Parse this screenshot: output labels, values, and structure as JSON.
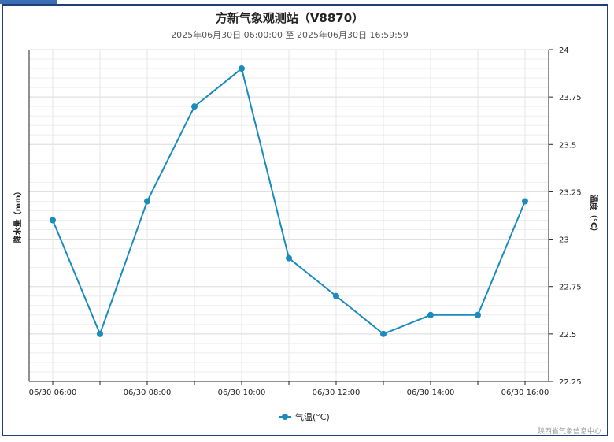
{
  "chart_data": {
    "type": "line",
    "title": "方新气象观测站（V8870）",
    "subtitle": "2025年06月30日 06:00:00 至 2025年06月30日 16:59:59",
    "ylabel_left": "降水量（mm）",
    "ylabel_right": "温度（°C）",
    "x": [
      "06:00",
      "07:00",
      "08:00",
      "09:00",
      "10:00",
      "11:00",
      "12:00",
      "13:00",
      "14:00",
      "15:00",
      "16:00"
    ],
    "x_tick_labels": [
      {
        "index": 0,
        "label": "06/30 06:00"
      },
      {
        "index": 2,
        "label": "06/30 08:00"
      },
      {
        "index": 4,
        "label": "06/30 10:00"
      },
      {
        "index": 6,
        "label": "06/30 12:00"
      },
      {
        "index": 8,
        "label": "06/30 14:00"
      },
      {
        "index": 10,
        "label": "06/30 16:00"
      }
    ],
    "series": [
      {
        "name": "气温(°C)",
        "color": "#1a8bbd",
        "axis": "right",
        "values": [
          23.1,
          22.5,
          23.2,
          23.7,
          23.9,
          22.9,
          22.7,
          22.5,
          22.6,
          22.6,
          23.2
        ]
      }
    ],
    "ylim_right": [
      22.25,
      24
    ],
    "y_ticks_right": [
      "24",
      "23.75",
      "23.5",
      "23.25",
      "23",
      "22.75",
      "22.5",
      "22.25"
    ],
    "grid": true,
    "legend_position": "bottom-center"
  },
  "credit": "陕西省气象信息中心"
}
